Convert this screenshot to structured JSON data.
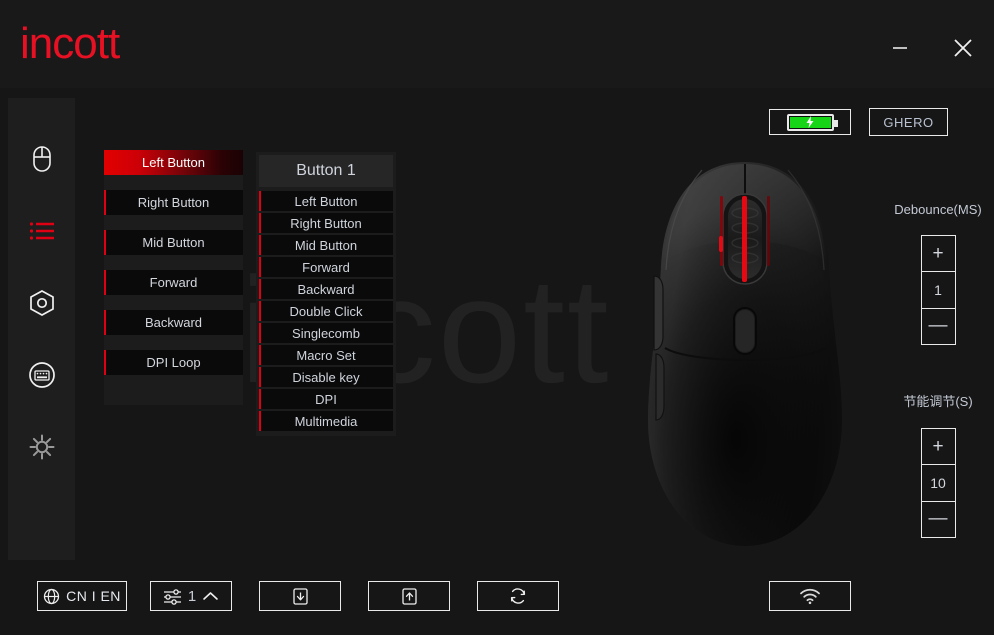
{
  "app": {
    "brand": "incott",
    "watermark": "incott"
  },
  "titlebar": {
    "minimize_label": "minimize-window",
    "close_label": "close-window",
    "icons": [
      "minimize-icon",
      "close-icon"
    ]
  },
  "sidebar": {
    "items": [
      {
        "name": "mouse",
        "icon": "mouse-icon",
        "active": false
      },
      {
        "name": "buttons",
        "icon": "list-icon",
        "active": true
      },
      {
        "name": "dpi",
        "icon": "hexagon-sensor-icon",
        "active": false
      },
      {
        "name": "macro",
        "icon": "keyboard-circle-icon",
        "active": false
      },
      {
        "name": "settings",
        "icon": "gear-icon",
        "active": false
      }
    ]
  },
  "button_list": {
    "items": [
      {
        "label": "Left Button",
        "selected": true
      },
      {
        "label": "Right Button",
        "selected": false
      },
      {
        "label": "Mid Button",
        "selected": false
      },
      {
        "label": "Forward",
        "selected": false
      },
      {
        "label": "Backward",
        "selected": false
      },
      {
        "label": "DPI Loop",
        "selected": false
      }
    ]
  },
  "assign_dropdown": {
    "header": "Button 1",
    "options": [
      "Left Button",
      "Right Button",
      "Mid Button",
      "Forward",
      "Backward",
      "Double Click",
      "Singlecomb",
      "Macro Set",
      "Disable key",
      "DPI",
      "Multimedia"
    ]
  },
  "status": {
    "battery_icon": "battery-charging-icon",
    "battery_level_percent": 100,
    "device_name": "GHERO"
  },
  "device": {
    "image_name": "gaming-mouse-top-view",
    "wheel_light_color": "#e50914",
    "body_color": "#2a2a2a"
  },
  "settings": {
    "debounce": {
      "label": "Debounce(MS)",
      "value": "1",
      "plus": "+",
      "minus": "—"
    },
    "power_save": {
      "label": "节能调节(S)",
      "value": "10",
      "plus": "+",
      "minus": "—"
    }
  },
  "toolbar": {
    "language": {
      "icon": "globe-icon",
      "label": "CN I EN"
    },
    "profile": {
      "icon": "sliders-icon",
      "value": "1",
      "chevron": "chevron-up-icon"
    },
    "import": {
      "icon": "download-file-icon"
    },
    "export": {
      "icon": "upload-file-icon"
    },
    "reset": {
      "icon": "refresh-icon"
    },
    "wireless": {
      "icon": "wifi-icon"
    }
  },
  "colors": {
    "accent_red": "#e00013",
    "brand_red": "#e81123",
    "background": "#161616",
    "panel": "#1e1e1e",
    "row": "#0a0a0a",
    "text": "#d3d7de",
    "battery_green": "#16d416"
  }
}
